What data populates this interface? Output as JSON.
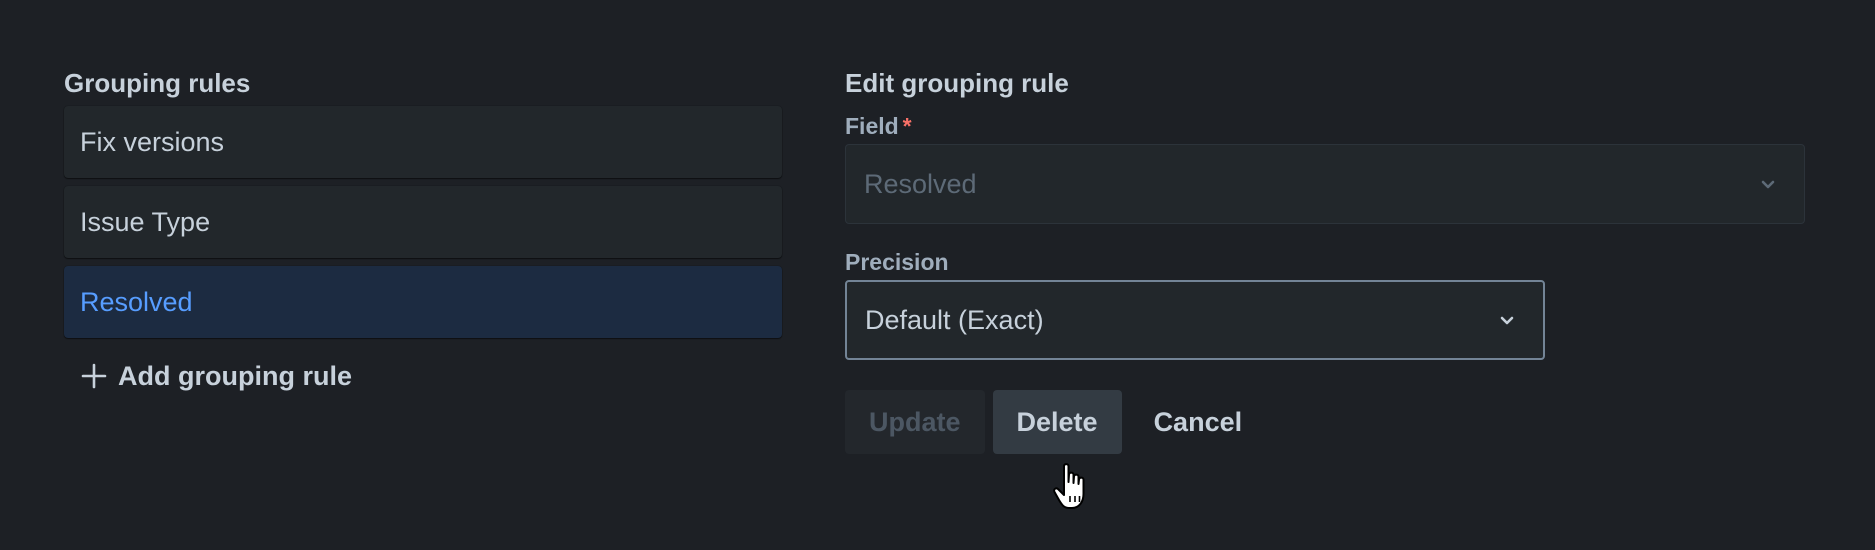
{
  "grouping_rules": {
    "title": "Grouping rules",
    "items": [
      {
        "label": "Fix versions"
      },
      {
        "label": "Issue Type"
      },
      {
        "label": "Resolved"
      }
    ],
    "add_label": "Add grouping rule"
  },
  "editor": {
    "title": "Edit grouping rule",
    "field_label": "Field",
    "required_mark": "*",
    "field_value": "Resolved",
    "precision_label": "Precision",
    "precision_value": "Default (Exact)",
    "update_label": "Update",
    "delete_label": "Delete",
    "cancel_label": "Cancel"
  },
  "colors": {
    "background": "#1d2025",
    "selected_item": "#1c2b41",
    "accent": "#579dff",
    "required": "#f87168"
  },
  "icons": [
    "plus-icon",
    "chevron-down-icon",
    "hand-pointer-cursor"
  ]
}
